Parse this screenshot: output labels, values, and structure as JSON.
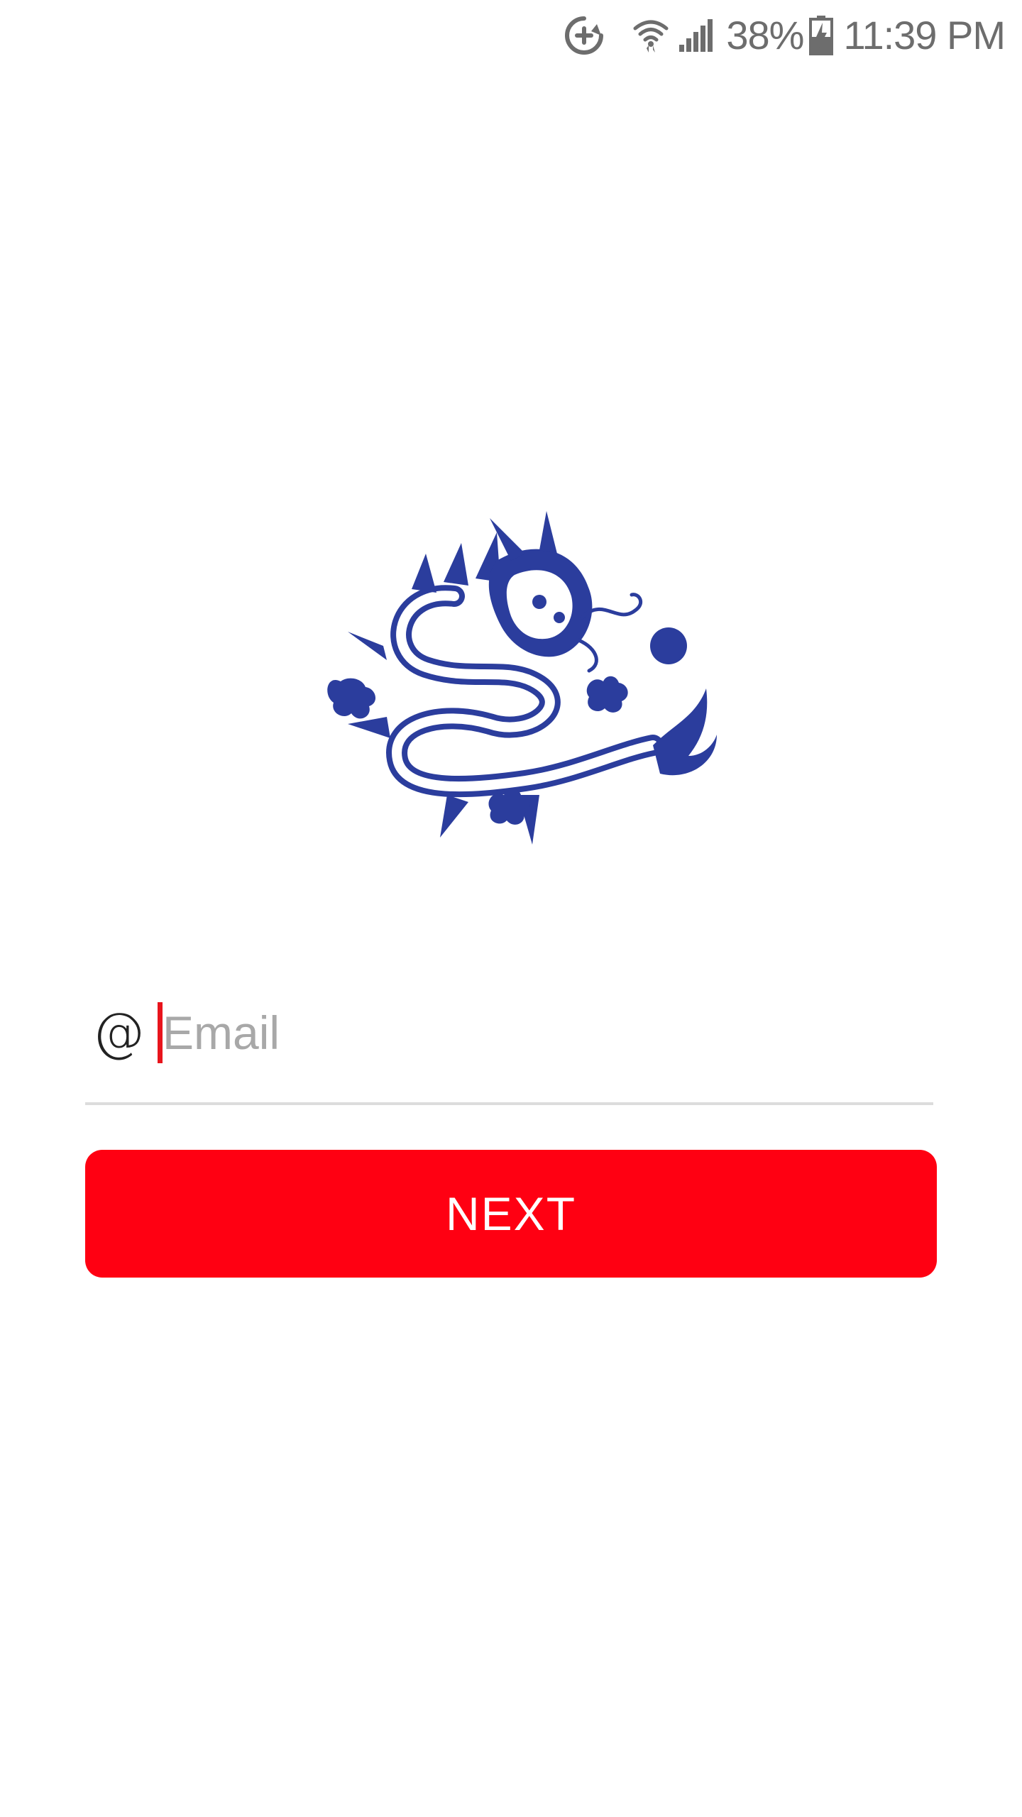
{
  "status_bar": {
    "battery_percent": "38%",
    "time": "11:39 PM",
    "icons": [
      "sync-plus-icon",
      "wifi-icon",
      "signal-icon",
      "battery-charging-icon"
    ]
  },
  "logo": {
    "icon": "dragon-logo",
    "color": "#2b3d9d"
  },
  "email_field": {
    "icon": "at-sign-icon",
    "icon_glyph": "@",
    "placeholder": "Email",
    "value": ""
  },
  "next_button": {
    "label": "NEXT",
    "color": "#ff0012"
  },
  "colors": {
    "accent": "#ff0012",
    "caret": "#e8141c",
    "logo_blue": "#2b3d9d",
    "placeholder": "#a8a8a8",
    "status_text": "#6d6d6d"
  }
}
